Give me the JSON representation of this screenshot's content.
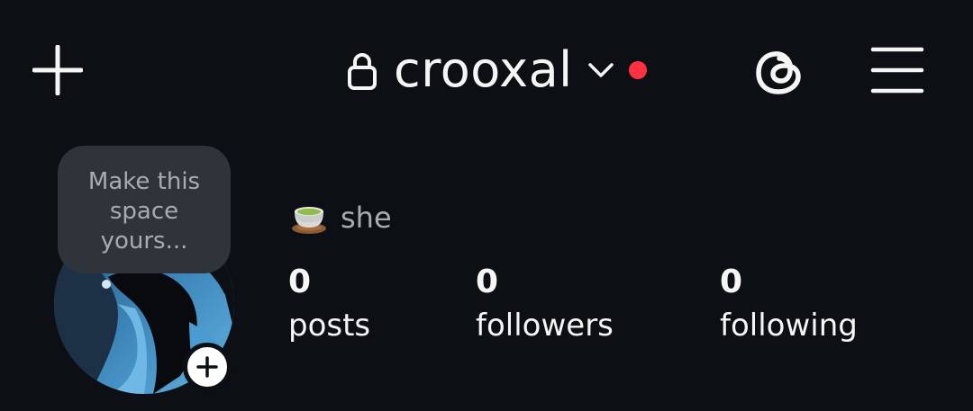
{
  "header": {
    "username": "crooxal",
    "new_post_icon": "plus-icon",
    "lock_icon": "lock-icon",
    "account_switch_icon": "chevron-down-icon",
    "threads_icon": "threads-icon",
    "menu_icon": "hamburger-menu-icon",
    "notification_dot_color": "#ff3040"
  },
  "note": {
    "text": "Make this space yours..."
  },
  "profile": {
    "pronoun_emoji_icon": "tea-cup-icon",
    "pronouns": "she",
    "add_story_icon": "plus-icon"
  },
  "stats": [
    {
      "value": "0",
      "label": "posts"
    },
    {
      "value": "0",
      "label": "followers"
    },
    {
      "value": "0",
      "label": "following"
    }
  ],
  "colors": {
    "background": "#0c1014",
    "primary_text": "#f5f5f5",
    "secondary_text": "#a8acb0",
    "note_bubble": "#2e3439",
    "notification_dot": "#ff3040"
  }
}
